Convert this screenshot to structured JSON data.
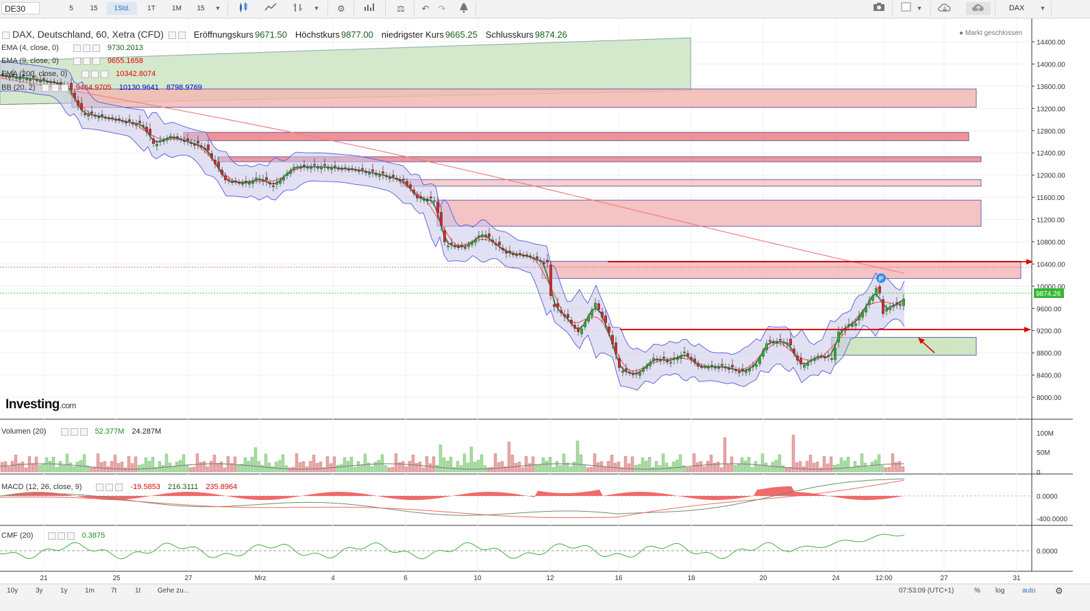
{
  "toolbar": {
    "symbol": "DE30",
    "timeframes": [
      "5",
      "15",
      "1Std.",
      "1T",
      "1M",
      "15"
    ],
    "active_timeframe": "1Std.",
    "right_symbol": "DAX",
    "icons": [
      "candles-icon",
      "line-chart-icon",
      "bar-chart-icon",
      "dropdown-icon",
      "gear-icon",
      "indicators-icon",
      "compare-icon",
      "undo-icon",
      "redo-icon",
      "alert-icon",
      "camera-icon",
      "color-icon",
      "cloud-download-icon",
      "cloud-upload-icon"
    ]
  },
  "legend": {
    "title": "DAX, Deutschland, 60, Xetra (CFD)",
    "open_label": "Eröffnungskurs",
    "open": "9671.50",
    "high_label": "Höchstkurs",
    "high": "9877.00",
    "low_label": "niedrigster Kurs",
    "low": "9665.25",
    "close_label": "Schlusskurs",
    "close": "9874.26",
    "market_status": "● Markt geschlossen"
  },
  "indicators": [
    {
      "label": "EMA (4, close, 0)",
      "value": "9730.2013",
      "color": "#1a5c1a"
    },
    {
      "label": "EMA (9, close, 0)",
      "value": "9655.1658",
      "color": "#e00000"
    },
    {
      "label": "EMA (200, close, 0)",
      "value": "10342.8074",
      "color": "#e00000"
    },
    {
      "label": "BB (20, 2)",
      "values": [
        "9464.9705",
        "10130.9641",
        "8798.9769"
      ],
      "colors": [
        "#e00000",
        "#0000cc",
        "#0000cc"
      ]
    }
  ],
  "volume_legend": {
    "label": "Volumen (20)",
    "v1": "52.377M",
    "v2": "24.287M"
  },
  "macd_legend": {
    "label": "MACD (12, 26, close, 9)",
    "v1": "-19.5853",
    "v2": "216.3111",
    "v3": "235.8964"
  },
  "cmf_legend": {
    "label": "CMF (20)",
    "v1": "0.3875"
  },
  "logo": {
    "main": "Investing",
    "suffix": ".com"
  },
  "chart_data": {
    "type": "candlestick",
    "y_axis": {
      "ticks": [
        "14400.00",
        "14000.00",
        "13600.00",
        "13200.00",
        "12800.00",
        "12400.00",
        "12000.00",
        "11600.00",
        "11200.00",
        "10800.00",
        "10400.00",
        "10000.00",
        "9600.00",
        "9200.00",
        "8800.00",
        "8400.00",
        "8000.00"
      ],
      "range": [
        7850,
        14550
      ]
    },
    "x_ticks": [
      {
        "label": "21",
        "x": 64
      },
      {
        "label": "25",
        "x": 170
      },
      {
        "label": "27",
        "x": 275
      },
      {
        "label": "Mrz",
        "x": 380
      },
      {
        "label": "4",
        "x": 486
      },
      {
        "label": "6",
        "x": 592
      },
      {
        "label": "10",
        "x": 697
      },
      {
        "label": "12",
        "x": 803
      },
      {
        "label": "16",
        "x": 903
      },
      {
        "label": "18",
        "x": 1009
      },
      {
        "label": "20",
        "x": 1114
      },
      {
        "label": "24",
        "x": 1220
      },
      {
        "label": "12:00",
        "x": 1290
      },
      {
        "label": "27",
        "x": 1378
      },
      {
        "label": "31",
        "x": 1484
      }
    ],
    "close_path": [
      {
        "x": 0,
        "v": 13800
      },
      {
        "x": 55,
        "v": 13720
      },
      {
        "x": 100,
        "v": 13620
      },
      {
        "x": 120,
        "v": 13120
      },
      {
        "x": 170,
        "v": 13000
      },
      {
        "x": 210,
        "v": 12900
      },
      {
        "x": 225,
        "v": 12550
      },
      {
        "x": 250,
        "v": 12700
      },
      {
        "x": 275,
        "v": 12600
      },
      {
        "x": 300,
        "v": 12500
      },
      {
        "x": 330,
        "v": 11900
      },
      {
        "x": 360,
        "v": 11850
      },
      {
        "x": 380,
        "v": 11950
      },
      {
        "x": 400,
        "v": 11800
      },
      {
        "x": 430,
        "v": 12150
      },
      {
        "x": 470,
        "v": 12150
      },
      {
        "x": 520,
        "v": 12100
      },
      {
        "x": 560,
        "v": 12000
      },
      {
        "x": 590,
        "v": 11900
      },
      {
        "x": 610,
        "v": 11580
      },
      {
        "x": 635,
        "v": 11550
      },
      {
        "x": 650,
        "v": 10750
      },
      {
        "x": 680,
        "v": 10700
      },
      {
        "x": 705,
        "v": 10950
      },
      {
        "x": 740,
        "v": 10600
      },
      {
        "x": 770,
        "v": 10550
      },
      {
        "x": 800,
        "v": 10400
      },
      {
        "x": 805,
        "v": 9700
      },
      {
        "x": 830,
        "v": 9400
      },
      {
        "x": 845,
        "v": 9150
      },
      {
        "x": 870,
        "v": 9700
      },
      {
        "x": 890,
        "v": 9150
      },
      {
        "x": 905,
        "v": 8500
      },
      {
        "x": 930,
        "v": 8400
      },
      {
        "x": 955,
        "v": 8700
      },
      {
        "x": 980,
        "v": 8650
      },
      {
        "x": 1000,
        "v": 8800
      },
      {
        "x": 1020,
        "v": 8550
      },
      {
        "x": 1060,
        "v": 8550
      },
      {
        "x": 1085,
        "v": 8450
      },
      {
        "x": 1105,
        "v": 8600
      },
      {
        "x": 1120,
        "v": 9000
      },
      {
        "x": 1150,
        "v": 9000
      },
      {
        "x": 1170,
        "v": 8550
      },
      {
        "x": 1195,
        "v": 8750
      },
      {
        "x": 1215,
        "v": 8700
      },
      {
        "x": 1225,
        "v": 9200
      },
      {
        "x": 1250,
        "v": 9350
      },
      {
        "x": 1275,
        "v": 9850
      },
      {
        "x": 1282,
        "v": 10050
      },
      {
        "x": 1288,
        "v": 9500
      },
      {
        "x": 1300,
        "v": 9650
      },
      {
        "x": 1315,
        "v": 9680
      },
      {
        "x": 1322,
        "v": 9874
      }
    ],
    "last_price_tag": "9874.26",
    "zones": [
      {
        "x1": 105,
        "x2": 1425,
        "top": 13550,
        "bottom": 13220,
        "fill": "#f2b8b3"
      },
      {
        "x1": 268,
        "x2": 1414,
        "top": 12770,
        "bottom": 12620,
        "fill": "#ef7f80"
      },
      {
        "x1": 318,
        "x2": 1432,
        "top": 12330,
        "bottom": 12240,
        "fill": "#ef8585"
      },
      {
        "x1": 585,
        "x2": 1432,
        "top": 11920,
        "bottom": 11800,
        "fill": "#f5c6c6"
      },
      {
        "x1": 638,
        "x2": 1432,
        "top": 11550,
        "bottom": 11080,
        "fill": "#f2b8b8"
      },
      {
        "x1": 791,
        "x2": 1490,
        "top": 10450,
        "bottom": 10140,
        "fill": "#f2b8b8"
      },
      {
        "x1": 1214,
        "x2": 1425,
        "top": 9080,
        "bottom": 8760,
        "fill": "#c6e2b6"
      }
    ],
    "volume_axis": {
      "ticks": [
        "100M",
        "50M",
        "0"
      ]
    },
    "macd_axis": {
      "ticks": [
        "0.0000",
        "-400.0000"
      ]
    },
    "cmf_axis": {
      "ticks": [
        "0.0000"
      ]
    }
  },
  "bottombar": {
    "ranges": [
      "10y",
      "3y",
      "1y",
      "1m",
      "7t",
      "1t",
      "Gehe zu..."
    ],
    "time": "07:53:09 (UTC+1)",
    "right": [
      "%",
      "log",
      "auto"
    ],
    "auto_color": "#2a6ebb"
  }
}
